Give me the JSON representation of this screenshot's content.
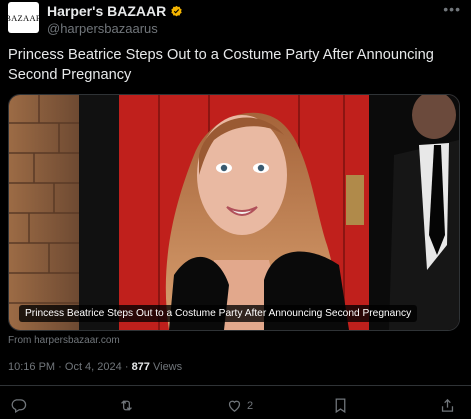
{
  "author": {
    "avatar_text": "BAZAAR",
    "display_name": "Harper's BAZAAR",
    "handle": "@harpersbazaarus",
    "verified_color": "#f4b400"
  },
  "tweet": {
    "text": "Princess Beatrice Steps Out to a Costume Party After Announcing Second Pregnancy"
  },
  "media": {
    "caption": "Princess Beatrice Steps Out to a Costume Party After Announcing Second Pregnancy"
  },
  "source": "From harpersbazaar.com",
  "meta": {
    "time": "10:16 PM",
    "date": "Oct 4, 2024",
    "separator": "·",
    "views_count": "877",
    "views_label": "Views"
  },
  "actions": {
    "reply_count": "",
    "repost_count": "",
    "like_count": "2",
    "bookmark_count": ""
  },
  "colors": {
    "background": "#000000",
    "text": "#e7e9ea",
    "muted": "#71767b",
    "divider": "#2f3336"
  }
}
